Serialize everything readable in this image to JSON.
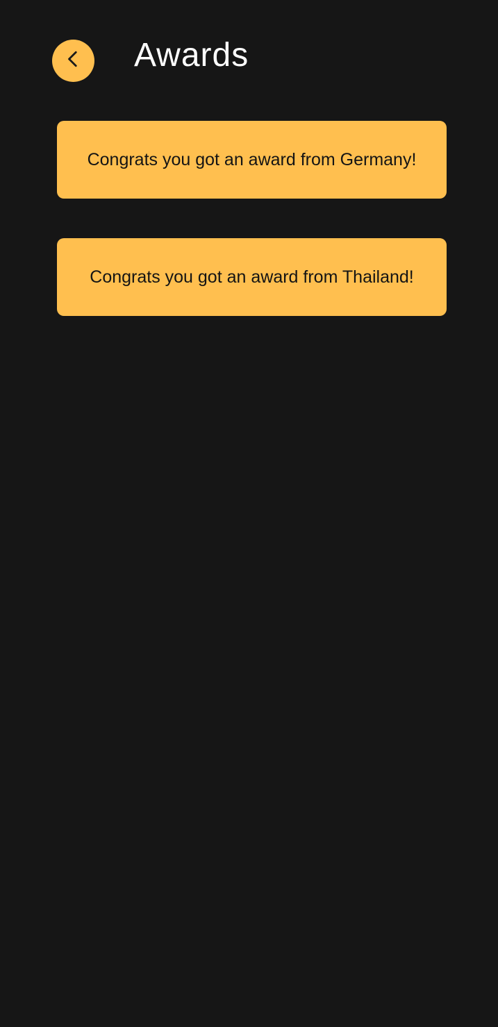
{
  "header": {
    "title": "Awards",
    "back_icon": "chevron-left-icon"
  },
  "awards": [
    {
      "message": "Congrats you got an award from Germany!"
    },
    {
      "message": "Congrats you got an award from Thailand!"
    }
  ],
  "colors": {
    "background": "#161616",
    "accent": "#ffbf4f",
    "title_text": "#ffffff",
    "card_text": "#141414"
  }
}
